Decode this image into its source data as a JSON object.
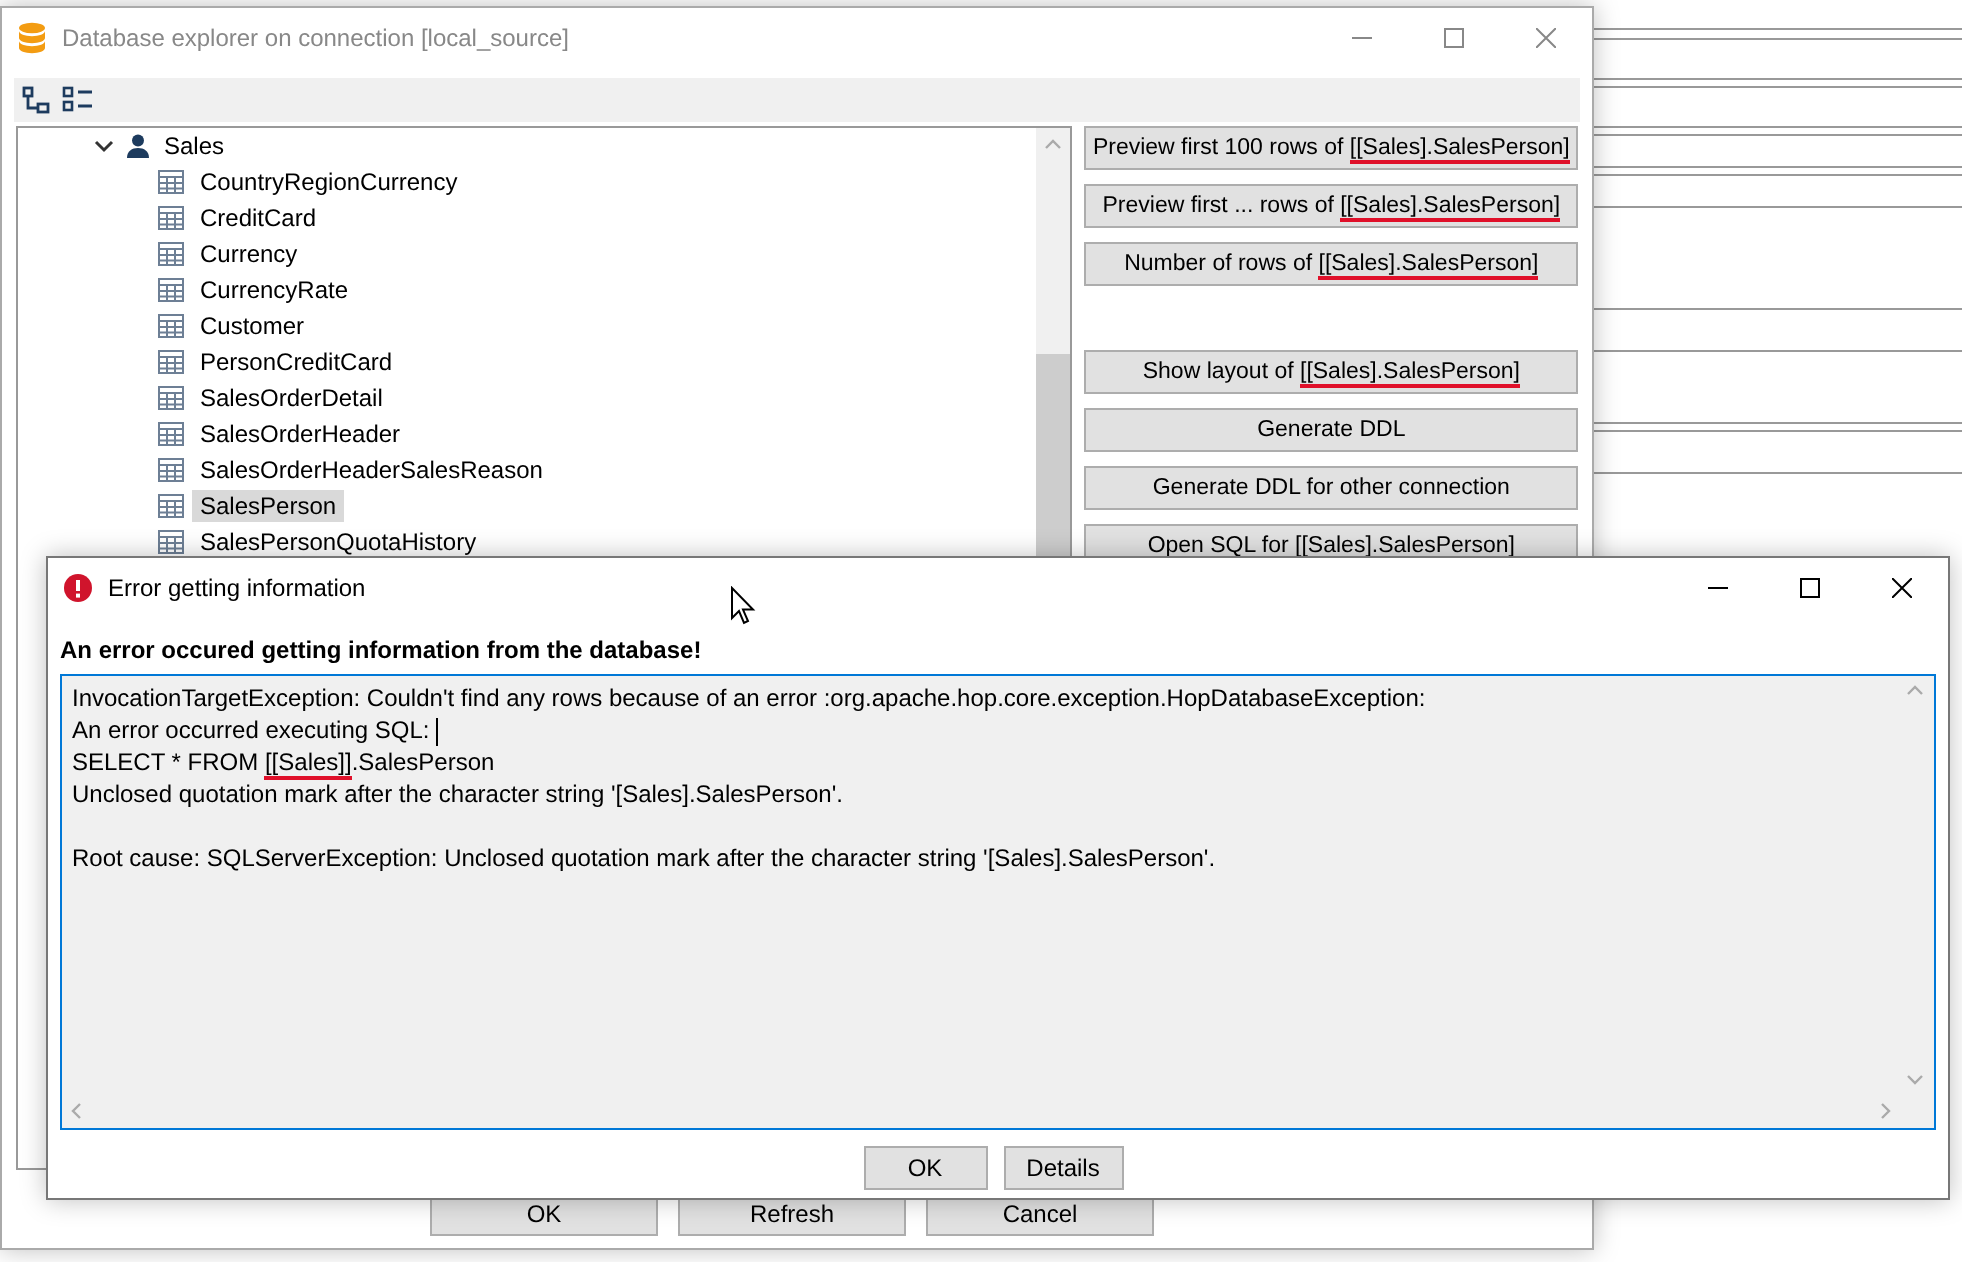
{
  "explorer": {
    "title": "Database explorer on connection [local_source]",
    "tree": {
      "label": "Sales",
      "expanded": true,
      "children": [
        {
          "label": "CountryRegionCurrency",
          "selected": false
        },
        {
          "label": "CreditCard",
          "selected": false
        },
        {
          "label": "Currency",
          "selected": false
        },
        {
          "label": "CurrencyRate",
          "selected": false
        },
        {
          "label": "Customer",
          "selected": false
        },
        {
          "label": "PersonCreditCard",
          "selected": false
        },
        {
          "label": "SalesOrderDetail",
          "selected": false
        },
        {
          "label": "SalesOrderHeader",
          "selected": false
        },
        {
          "label": "SalesOrderHeaderSalesReason",
          "selected": false
        },
        {
          "label": "SalesPerson",
          "selected": true
        },
        {
          "label": "SalesPersonQuotaHistory",
          "selected": false
        }
      ]
    },
    "action_groups": [
      [
        {
          "text": "Preview first 100 rows of ",
          "target": "[[Sales].SalesPerson]",
          "marked": true
        },
        {
          "text": "Preview first ... rows of ",
          "target": "[[Sales].SalesPerson]",
          "marked": true
        },
        {
          "text": "Number of rows of ",
          "target": "[[Sales].SalesPerson]",
          "marked": true
        }
      ],
      [
        {
          "text": "Show layout of ",
          "target": "[[Sales].SalesPerson]",
          "marked": true
        },
        {
          "text": "Generate DDL"
        },
        {
          "text": "Generate DDL for other connection"
        },
        {
          "text": "Open SQL for ",
          "target": "[[Sales].SalesPerson]"
        }
      ]
    ],
    "buttons": [
      "OK",
      "Refresh",
      "Cancel"
    ]
  },
  "error_dialog": {
    "title": "Error getting information",
    "heading": "An error occured getting information from the database!",
    "lines": [
      {
        "kind": "text",
        "parts": [
          {
            "text": "InvocationTargetException: Couldn't find any rows because of an error :org.apache.hop.core.exception.HopDatabaseException:",
            "marked": false
          }
        ],
        "cursor": false
      },
      {
        "kind": "text",
        "parts": [
          {
            "text": "An error occurred executing SQL: ",
            "marked": false
          }
        ],
        "cursor": true
      },
      {
        "kind": "text",
        "parts": [
          {
            "text": "SELECT * FROM ",
            "marked": false
          },
          {
            "text": "[[Sales]]",
            "marked": true
          },
          {
            "text": ".SalesPerson",
            "marked": false
          }
        ],
        "cursor": false
      },
      {
        "kind": "text",
        "parts": [
          {
            "text": "Unclosed quotation mark after the character string '[Sales].SalesPerson'.",
            "marked": false
          }
        ],
        "cursor": false
      },
      {
        "kind": "blank"
      },
      {
        "kind": "text",
        "parts": [
          {
            "text": "Root cause: SQLServerException: Unclosed quotation mark after the character string '[Sales].SalesPerson'.",
            "marked": false
          }
        ],
        "cursor": false
      }
    ],
    "buttons": [
      "OK",
      "Details"
    ]
  }
}
